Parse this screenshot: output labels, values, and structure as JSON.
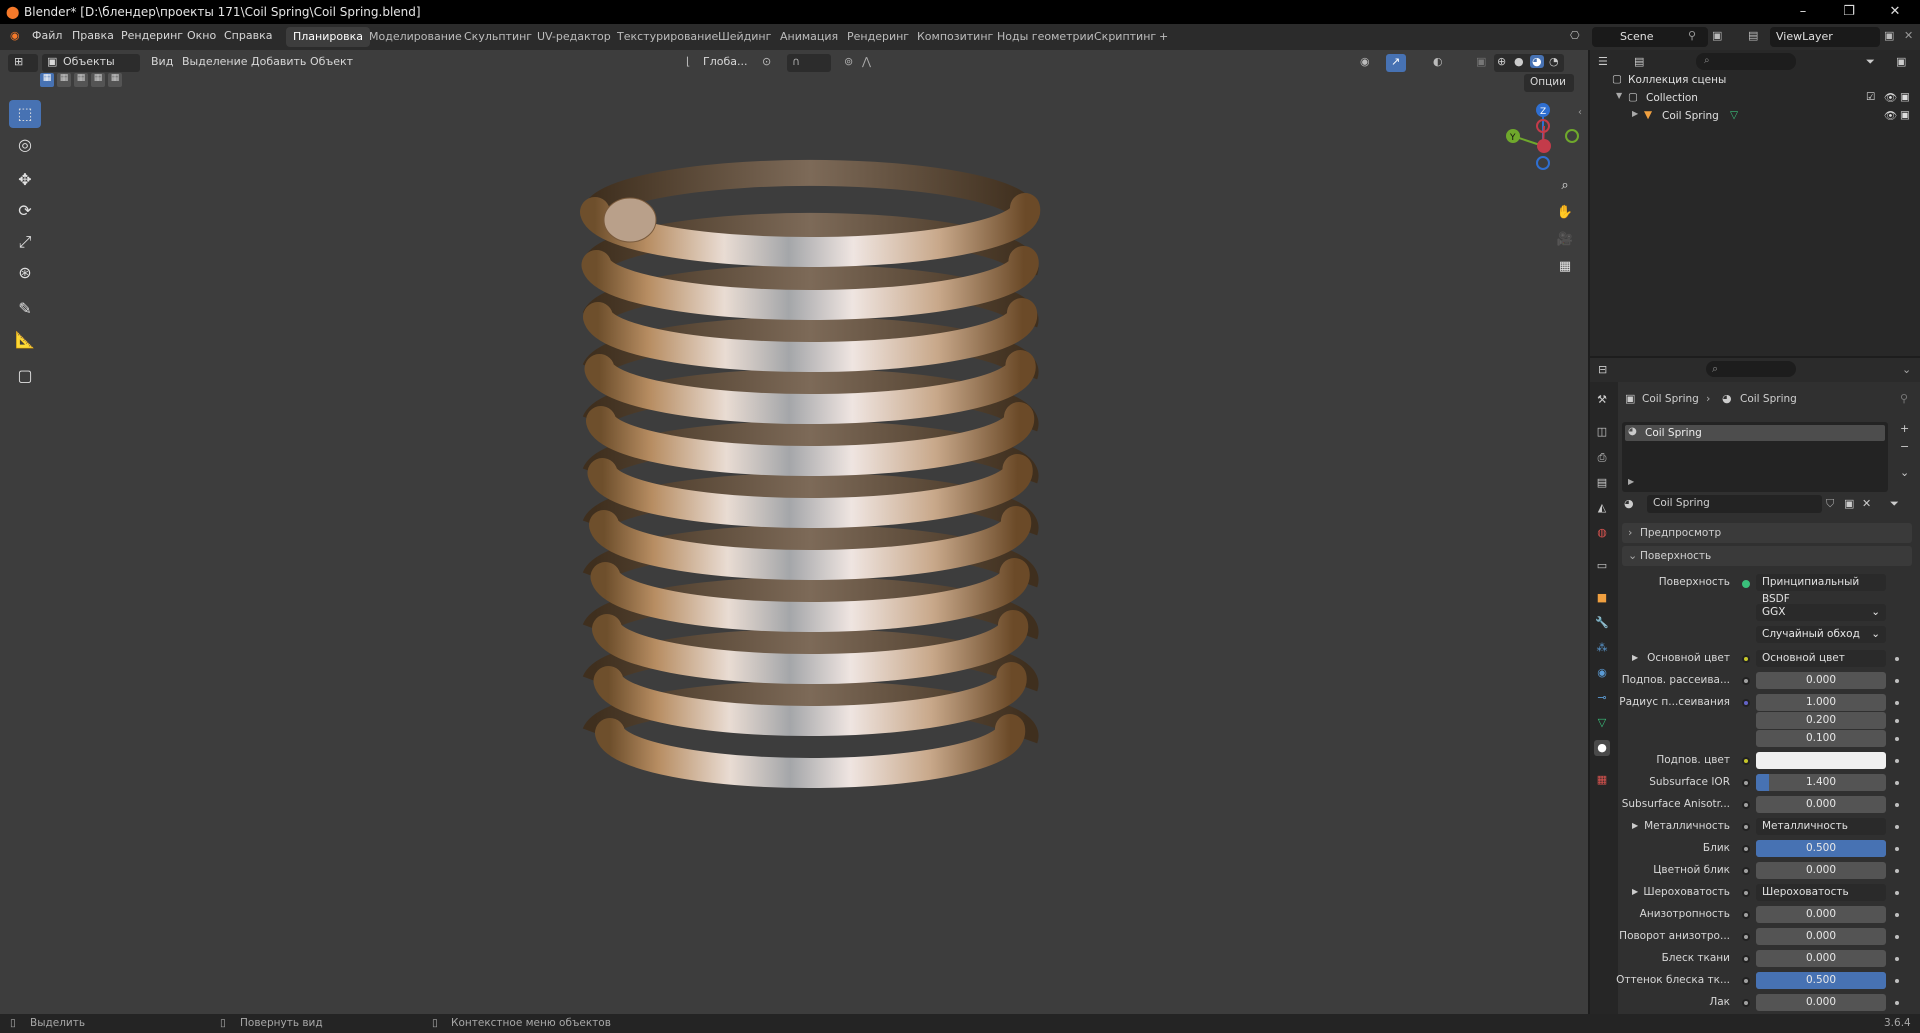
{
  "window": {
    "title": "Blender* [D:\\блендер\\проекты 171\\Coil Spring\\Coil Spring.blend]",
    "buttons": [
      "–",
      "❐",
      "✕"
    ]
  },
  "menu": [
    "Файл",
    "Правка",
    "Рендеринг",
    "Окно",
    "Справка"
  ],
  "workspaces": [
    "Планировка",
    "Моделирование",
    "Скульптинг",
    "UV-редактор",
    "Текстурирование",
    "Шейдинг",
    "Анимация",
    "Рендеринг",
    "Композитинг",
    "Ноды геометрии",
    "Скриптинг",
    "+"
  ],
  "scene": {
    "label": "Scene",
    "view_layer": "ViewLayer"
  },
  "viewport": {
    "mode": "Объекты",
    "menus": [
      "Вид",
      "Выделение",
      "Добавить",
      "Объект"
    ],
    "orientation": "Глоба...",
    "options": "Опции",
    "gizmo": {
      "x": "X",
      "y": "Y",
      "z": "Z"
    }
  },
  "outliner": {
    "scene_collection": "Коллекция сцены",
    "collection": "Collection",
    "object": "Coil Spring"
  },
  "properties": {
    "breadcrumb_object": "Coil Spring",
    "breadcrumb_material": "Coil Spring",
    "slot": "Coil Spring",
    "material_name": "Coil Spring",
    "sections": {
      "preview": "Предпросмотр",
      "surface": "Поверхность"
    },
    "surface_label": "Поверхность",
    "surface_value": "Принципиальный BSDF",
    "distribution": "GGX",
    "subsurface_method": "Случайный обход",
    "rows": [
      {
        "label": "Основной цвет",
        "kind": "link",
        "value": "Основной цвет",
        "dot": "#c7c729"
      },
      {
        "label": "Подпов. рассеива...",
        "kind": "num",
        "value": "0.000",
        "dot": "#a1a1a1"
      },
      {
        "label": "Радиус п...сеивания",
        "kind": "num",
        "value": "1.000",
        "dot": "#6363c7"
      },
      {
        "label": "",
        "kind": "num",
        "value": "0.200"
      },
      {
        "label": "",
        "kind": "num",
        "value": "0.100"
      },
      {
        "label": "Подпов. цвет",
        "kind": "color",
        "value": "",
        "dot": "#c7c729"
      },
      {
        "label": "Subsurface IOR",
        "kind": "num",
        "value": "1.400",
        "fill": 0.1,
        "dot": "#a1a1a1"
      },
      {
        "label": "Subsurface Anisotr...",
        "kind": "num",
        "value": "0.000",
        "dot": "#a1a1a1"
      },
      {
        "label": "Металличность",
        "kind": "link",
        "value": "Металличность",
        "dot": "#a1a1a1"
      },
      {
        "label": "Блик",
        "kind": "num",
        "value": "0.500",
        "fill": 1.0,
        "dot": "#a1a1a1"
      },
      {
        "label": "Цветной блик",
        "kind": "num",
        "value": "0.000",
        "dot": "#a1a1a1"
      },
      {
        "label": "Шероховатость",
        "kind": "link",
        "value": "Шероховатость",
        "dot": "#a1a1a1"
      },
      {
        "label": "Анизотропность",
        "kind": "num",
        "value": "0.000",
        "dot": "#a1a1a1"
      },
      {
        "label": "Поворот анизотро...",
        "kind": "num",
        "value": "0.000",
        "dot": "#a1a1a1"
      },
      {
        "label": "Блеск ткани",
        "kind": "num",
        "value": "0.000",
        "dot": "#a1a1a1"
      },
      {
        "label": "Оттенок блеска тк...",
        "kind": "num",
        "value": "0.500",
        "fill": 1.0,
        "dot": "#a1a1a1"
      },
      {
        "label": "Лак",
        "kind": "num",
        "value": "0.000",
        "dot": "#a1a1a1"
      }
    ]
  },
  "statusbar": {
    "select": "Выделить",
    "rotate": "Повернуть вид",
    "context": "Контекстное меню объектов",
    "version": "3.6.4"
  },
  "colors": {
    "accent": "#4772b3",
    "brand": "#f5792a"
  }
}
